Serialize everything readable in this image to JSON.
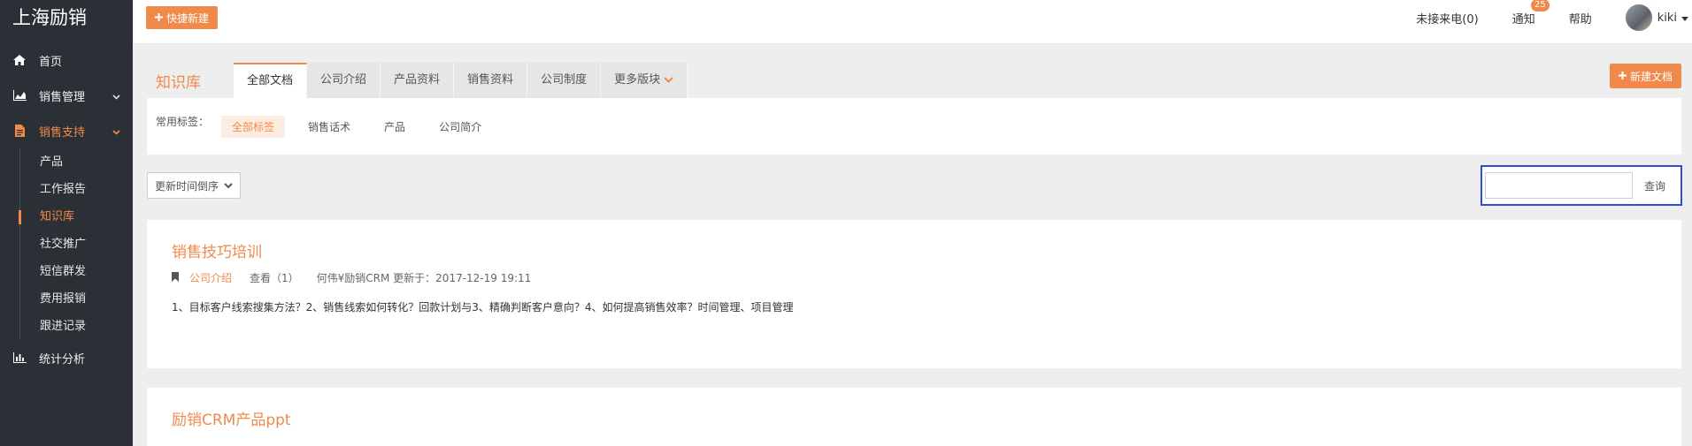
{
  "sidebar": {
    "brand": "上海励销",
    "items": [
      {
        "label": "首页",
        "icon": "home-icon"
      },
      {
        "label": "销售管理",
        "icon": "area-chart-icon"
      },
      {
        "label": "销售支持",
        "icon": "file-text-icon"
      },
      {
        "label": "统计分析",
        "icon": "bar-chart-icon"
      }
    ],
    "sub_items": [
      "产品",
      "工作报告",
      "知识库",
      "社交推广",
      "短信群发",
      "费用报销",
      "跟进记录"
    ],
    "active_sub": "知识库"
  },
  "topbar": {
    "quick_new_label": "快捷新建",
    "missed_calls": "未接来电(0)",
    "notify_label": "通知",
    "notify_count": "25",
    "help_label": "帮助",
    "user_name": "kiki"
  },
  "kb": {
    "title": "知识库",
    "tabs": [
      "全部文档",
      "公司介绍",
      "产品资料",
      "销售资料",
      "公司制度",
      "更多版块"
    ],
    "active_tab": "全部文档",
    "new_doc_label": "新建文档",
    "tag_label": "常用标签：",
    "tags": [
      "全部标签",
      "销售话术",
      "产品",
      "公司简介"
    ],
    "active_tag": "全部标签",
    "sort_label": "更新时间倒序",
    "search_placeholder": "",
    "search_button": "查询"
  },
  "docs": [
    {
      "title": "销售技巧培训",
      "category": "公司介绍",
      "views": "查看（1）",
      "updated": "何伟¥励销CRM 更新于：2017-12-19 19:11",
      "summary": "1、目标客户线索搜集方法？2、销售线索如何转化？回款计划与3、精确判断客户意向？4、如何提高销售效率？时间管理、项目管理"
    },
    {
      "title": "励销CRM产品ppt"
    }
  ],
  "colors": {
    "accent": "#f08a4b",
    "sidebar_bg": "#2b2f36",
    "highlight_border": "#2d4fd6",
    "annotation_arrow": "#e8302e"
  }
}
